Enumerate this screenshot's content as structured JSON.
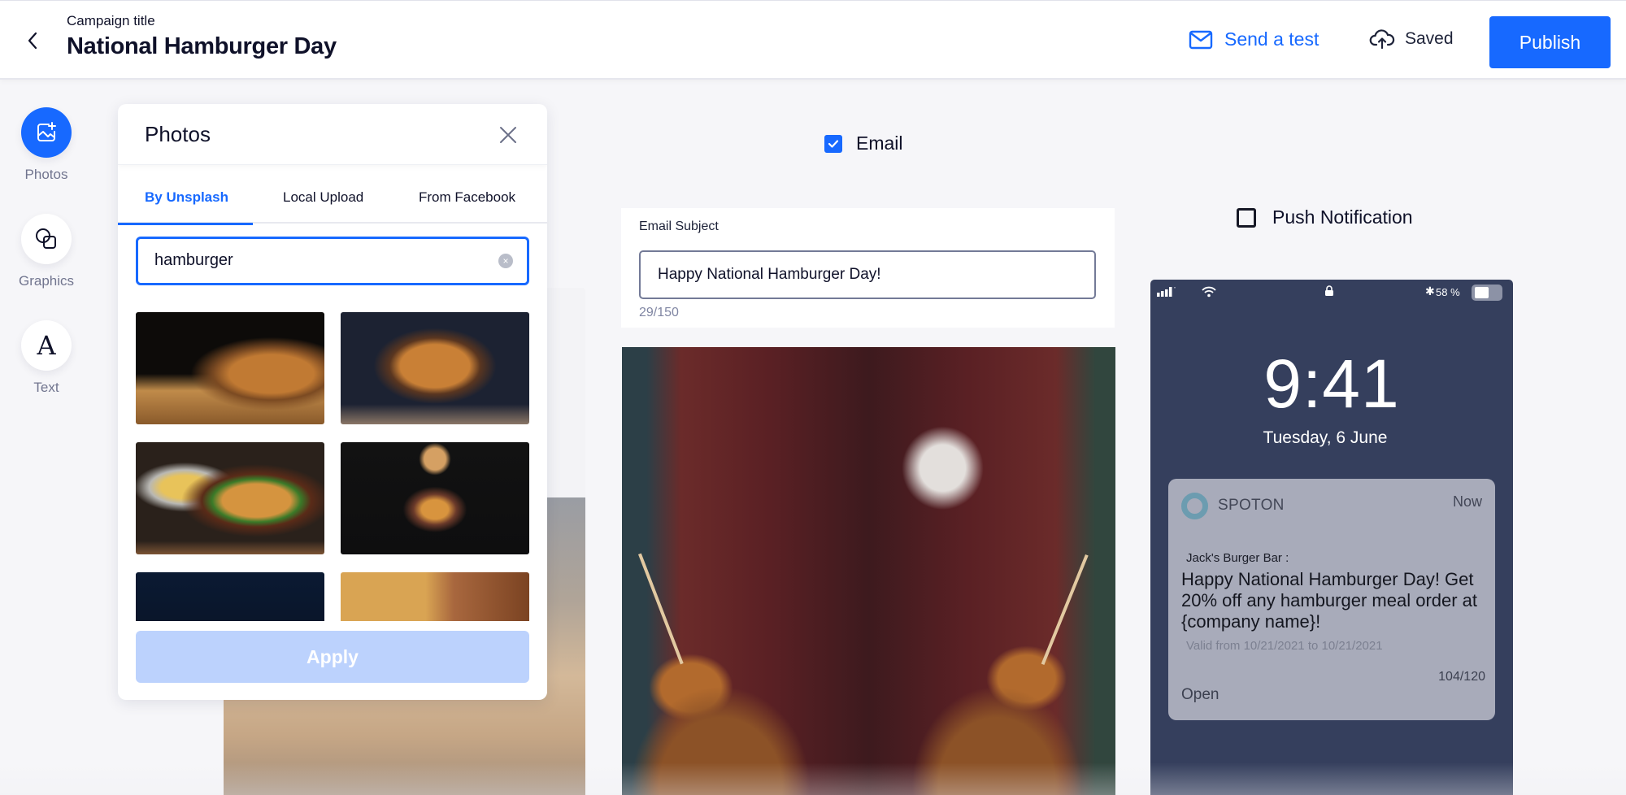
{
  "header": {
    "back_icon": "chevron-left-icon",
    "campaign_label": "Campaign title",
    "campaign_title": "National Hamburger Day",
    "send_test_label": "Send a test",
    "send_test_icon": "mail-icon",
    "saved_label": "Saved",
    "saved_icon": "cloud-upload-icon",
    "publish_label": "Publish",
    "accent_color": "#1769ff"
  },
  "tools": [
    {
      "label": "Photos",
      "icon": "image-plus-icon",
      "active": true
    },
    {
      "label": "Graphics",
      "icon": "shapes-icon",
      "active": false
    },
    {
      "label": "Text",
      "icon": "text-icon",
      "active": false
    }
  ],
  "photos_panel": {
    "title": "Photos",
    "close_icon": "close-icon",
    "tabs": [
      {
        "label": "By Unsplash",
        "active": true
      },
      {
        "label": "Local Upload",
        "active": false
      },
      {
        "label": "From Facebook",
        "active": false
      }
    ],
    "search_value": "hamburger",
    "search_clear_glyph": "×",
    "results": [
      {
        "alt": "Burger with fries on wooden board"
      },
      {
        "alt": "Double cheeseburger on dark background"
      },
      {
        "alt": "Burger with fries in metal cup"
      },
      {
        "alt": "Floating deconstructed burger"
      },
      {
        "alt": "Sesame bun on dark blue background"
      },
      {
        "alt": "Fries, bacon and burger"
      }
    ],
    "apply_label": "Apply"
  },
  "email": {
    "checkbox_label": "Email",
    "checked": true,
    "subject_label": "Email Subject",
    "subject_value": "Happy National Hamburger Day!",
    "subject_count": "29/150",
    "hero_image_alt": "Person holding two burgers topped with fried balls on sticks"
  },
  "push": {
    "checkbox_label": "Push Notification",
    "checked": false,
    "phone": {
      "battery_pct": "58 %",
      "battery_level": 0.58,
      "time": "9:41",
      "date": "Tuesday, 6 June",
      "notification": {
        "app": "SPOTON",
        "time": "Now",
        "sender": "Jack's Burger Bar :",
        "body": "Happy National Hamburger Day! Get 20% off any hamburger meal order at {company name}!",
        "valid": "Valid from 10/21/2021 to 10/21/2021",
        "count": "104/120",
        "action": "Open"
      }
    }
  }
}
